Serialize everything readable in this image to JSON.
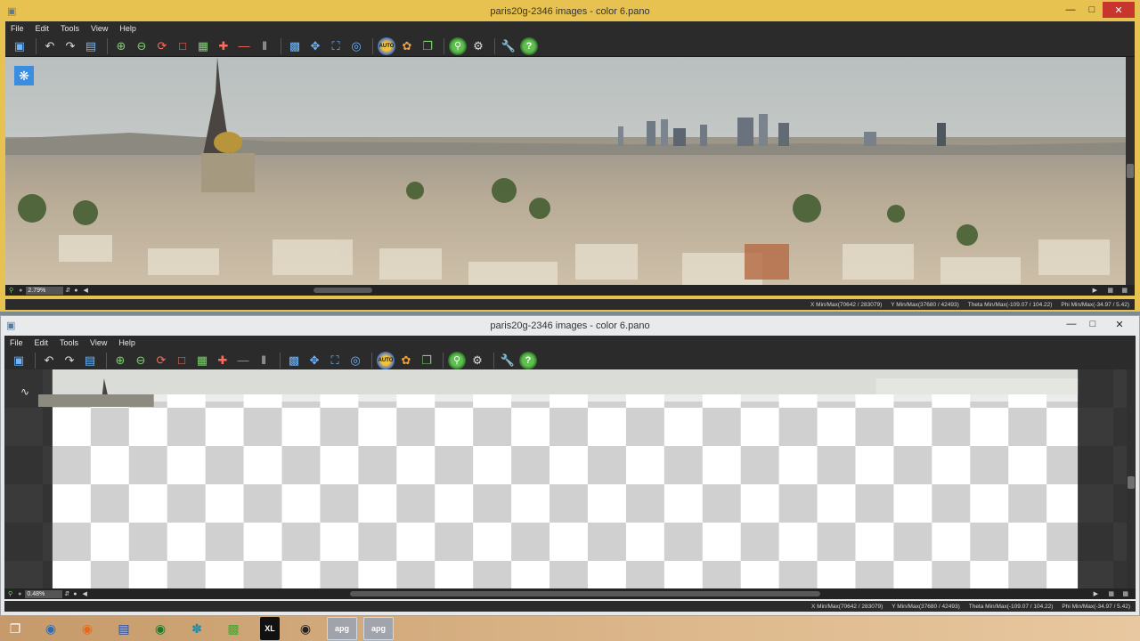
{
  "windows": [
    {
      "title": "paris20g-2346 images - color 6.pano",
      "menu": [
        "File",
        "Edit",
        "Tools",
        "View",
        "Help"
      ],
      "zoom": "2.79%",
      "coords": {
        "x": "X Min/Max(70642 / 283079)",
        "y": "Y Min/Max(37680 / 42493)",
        "theta": "Theta Min/Max(-109.07 / 104.22)",
        "phi": "Phi Min/Max(-34.97 / 5.42)"
      }
    },
    {
      "title": "paris20g-2346 images - color 6.pano",
      "menu": [
        "File",
        "Edit",
        "Tools",
        "View",
        "Help"
      ],
      "zoom": "0.48%",
      "coords": {
        "x": "X Min/Max(70642 / 283079)",
        "y": "Y Min/Max(37680 / 42493)",
        "theta": "Theta Min/Max(-109.07 / 104.22)",
        "phi": "Phi Min/Max(-34.97 / 5.42)"
      }
    }
  ],
  "toolbar_icons": [
    "monitor-icon",
    "undo-icon",
    "redo-icon",
    "histogram-icon",
    "zoom-in-icon",
    "zoom-out-icon",
    "rotate-icon",
    "crop-icon",
    "grid-icon",
    "split-icon",
    "line-icon",
    "bars-icon",
    "move-icon",
    "pan-icon",
    "fit-icon",
    "target-icon",
    "auto-icon",
    "color-icon",
    "layers-icon",
    "search-icon",
    "gear-icon",
    "wrench-icon",
    "help-icon"
  ],
  "taskbar": {
    "xl_label": "XL",
    "apg_label": "apg"
  },
  "colors": {
    "active_border": "#e8c250",
    "close_button": "#c7352c",
    "toolbar": "#2b2b2b"
  }
}
